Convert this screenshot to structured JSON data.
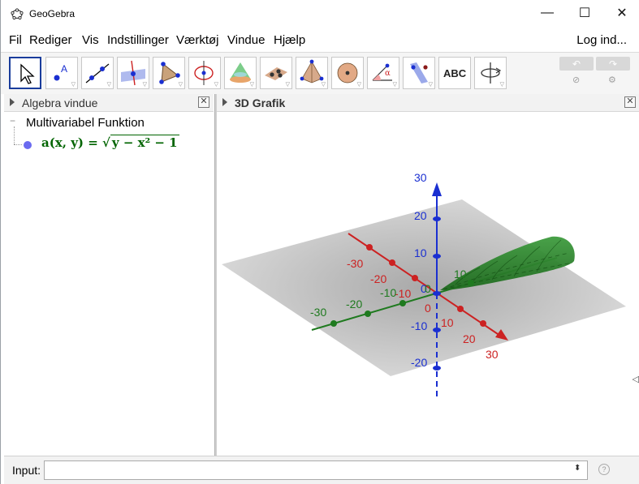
{
  "window": {
    "title": "GeoGebra",
    "controls": {
      "minimize": "—",
      "maximize": "☐",
      "close": "✕"
    }
  },
  "menu": {
    "items": [
      "Fil",
      "Rediger",
      "Vis",
      "Indstillinger",
      "Værktøj",
      "Vindue",
      "Hjælp"
    ],
    "login": "Log ind..."
  },
  "toolbar": {
    "tools": [
      "move-tool",
      "point-tool",
      "line-tool",
      "perpendicular-line-tool",
      "polygon-tool",
      "circle-tool",
      "cone-tool",
      "plane-tool",
      "pyramid-tool",
      "sphere-tool",
      "angle-tool",
      "reflect-tool",
      "text-tool",
      "rotate-view-tool"
    ],
    "text_tool_label": "ABC",
    "undo": "↶",
    "redo": "↷",
    "help_icon": "help-icon",
    "settings_icon": "gear-icon"
  },
  "algebra": {
    "title": "Algebra vindue",
    "category": "Multivariabel Funktion",
    "objects": [
      {
        "name": "a",
        "args": "(x, y)",
        "definition": "a(x, y) = √(y − x² − 1)",
        "color": "#006400",
        "dot_color": "#6b6bf0"
      }
    ]
  },
  "graphics3d": {
    "title": "3D Grafik",
    "x_axis_color": "#cc2222",
    "y_axis_color": "#1f7a1f",
    "z_axis_color": "#1a2fd1",
    "surface_color": "#2e8b2e",
    "x_ticks": [
      "-30",
      "-20",
      "-10",
      "0",
      "10",
      "20",
      "30"
    ],
    "y_ticks": [
      "-30",
      "-20",
      "-10",
      "0",
      "10"
    ],
    "z_ticks": [
      "30",
      "20",
      "10",
      "0",
      "-10",
      "-20"
    ]
  },
  "input": {
    "label": "Input:",
    "value": "",
    "placeholder": ""
  }
}
